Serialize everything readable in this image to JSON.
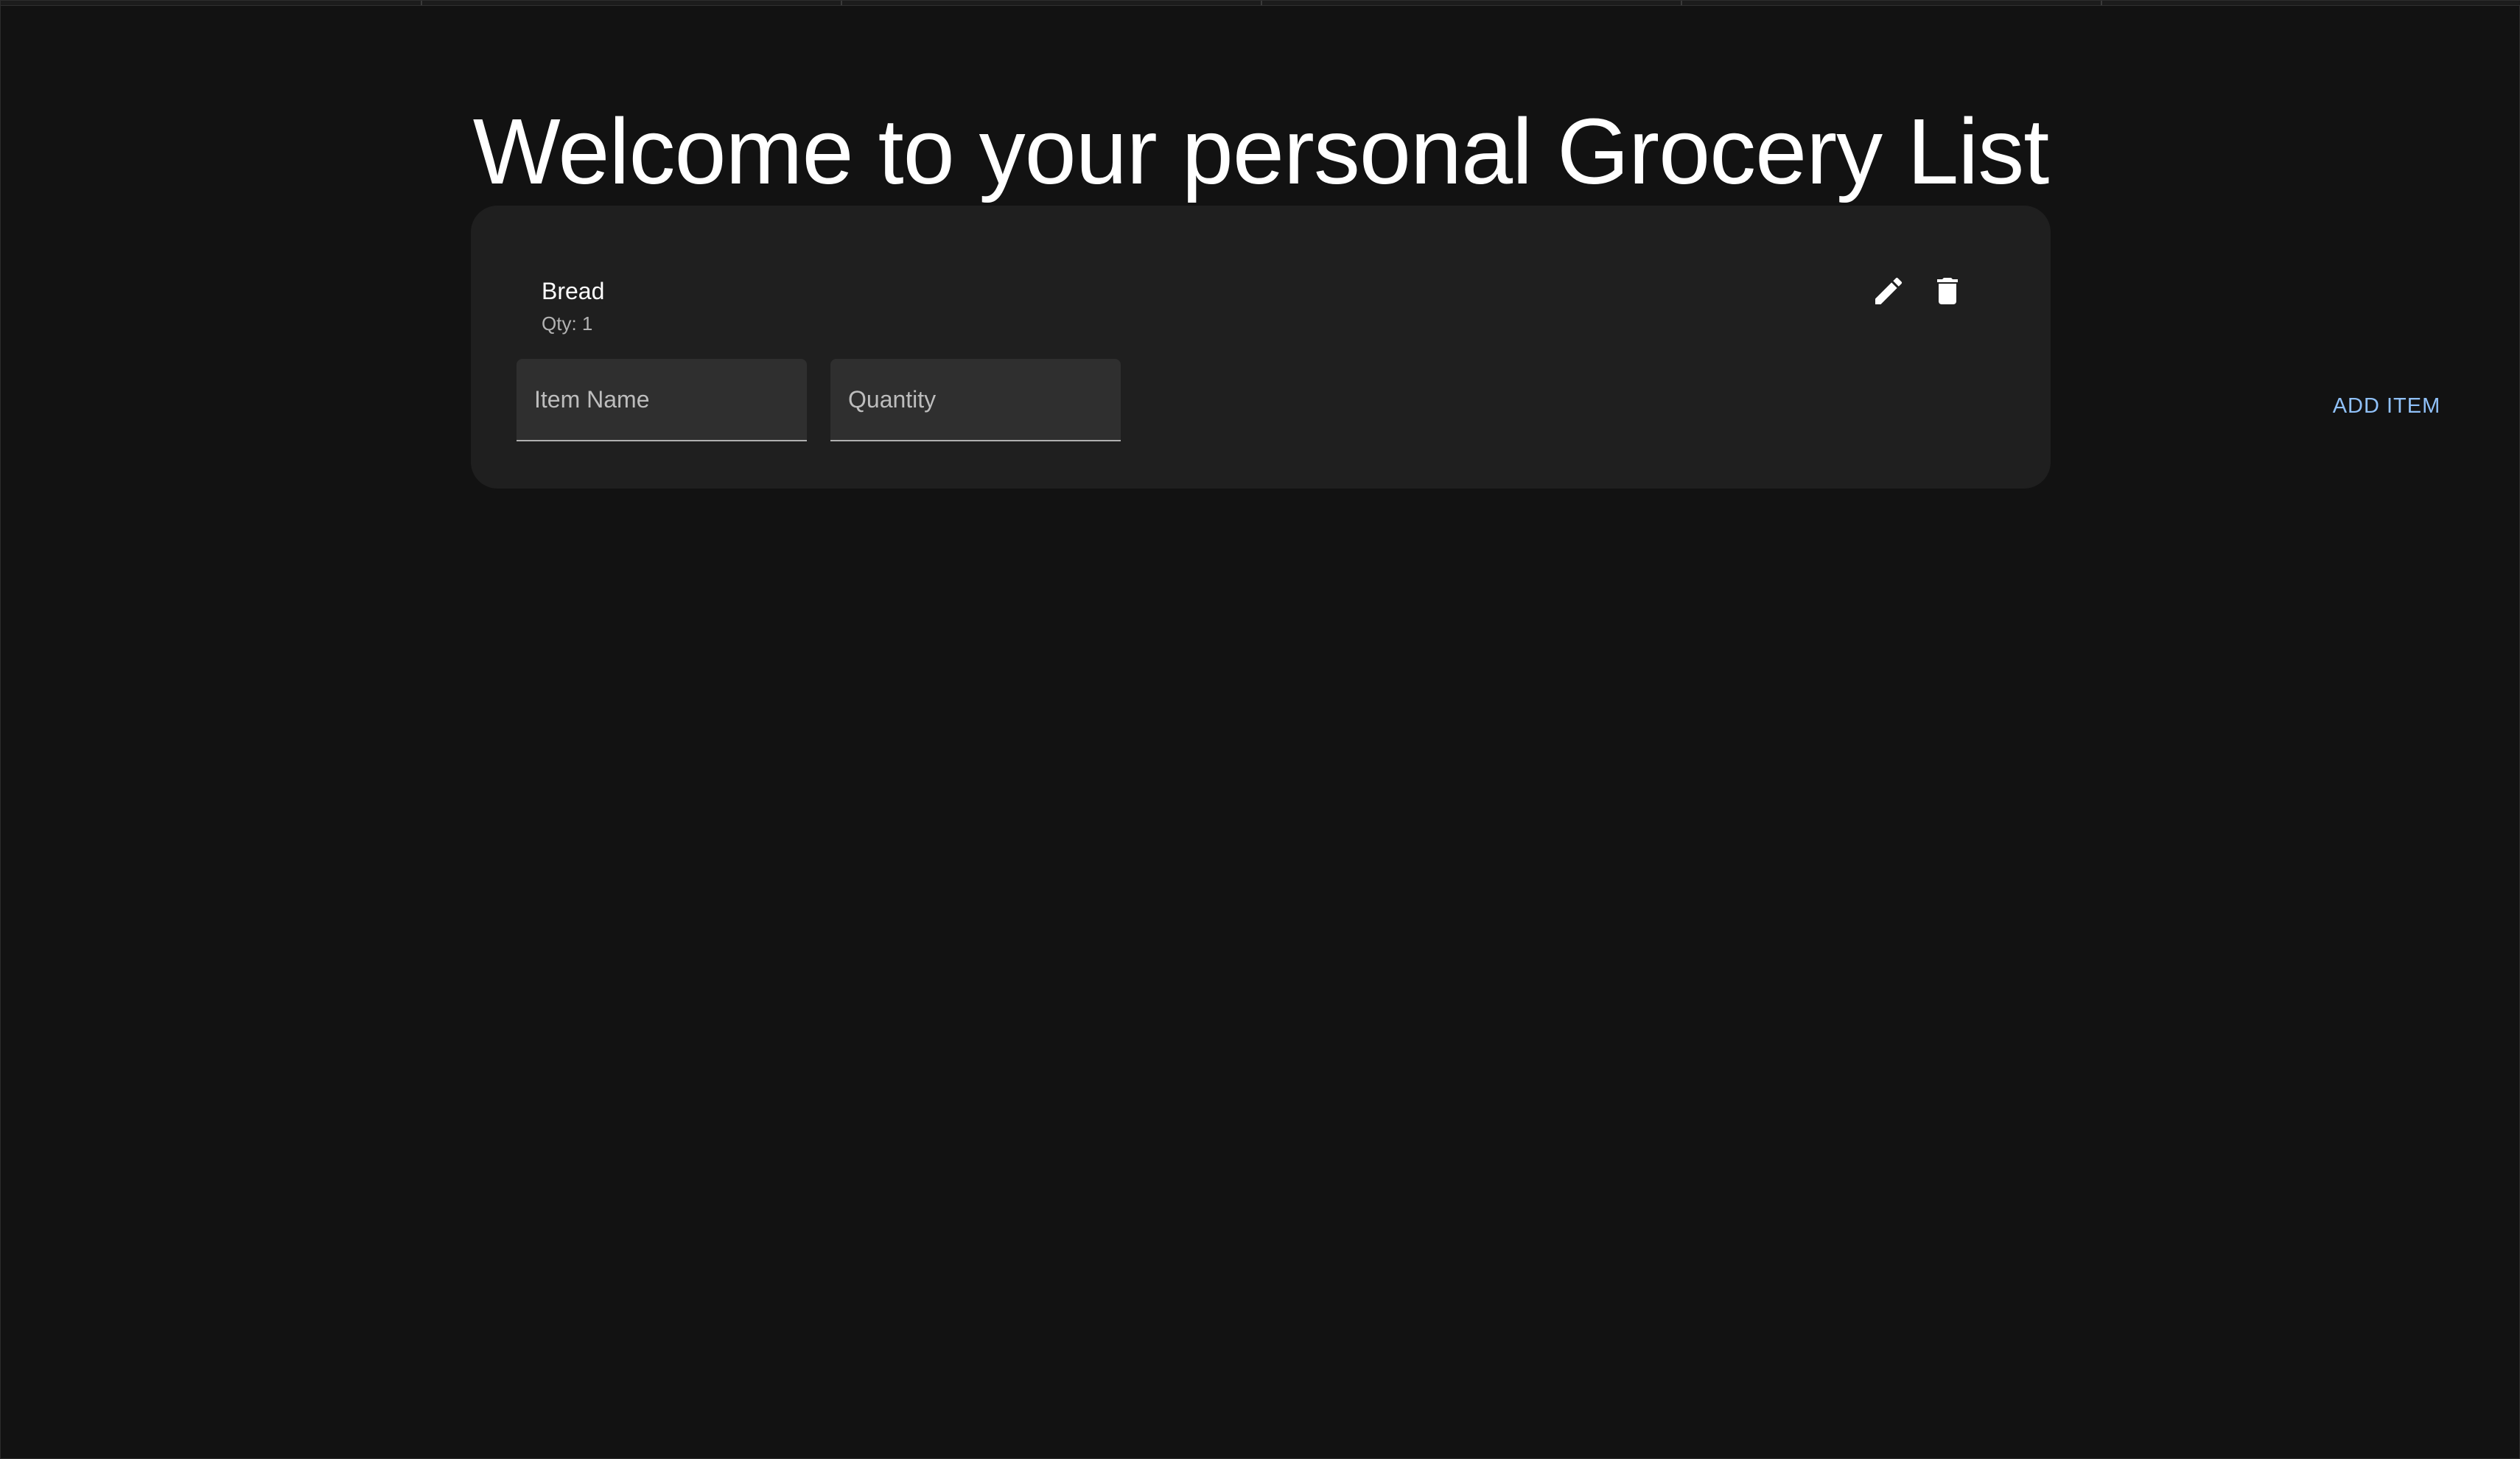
{
  "page": {
    "title": "Welcome to your personal Grocery List"
  },
  "items": [
    {
      "name": "Bread",
      "qty_label": "Qty: 1"
    }
  ],
  "form": {
    "name_placeholder": "Item Name",
    "quantity_placeholder": "Quantity",
    "add_label": "ADD ITEM"
  },
  "icons": {
    "edit": "pencil-icon",
    "delete": "trash-icon"
  },
  "colors": {
    "background": "#121212",
    "card": "#1f1f1f",
    "accent": "#90c1f9",
    "field": "#2f2f2f"
  }
}
